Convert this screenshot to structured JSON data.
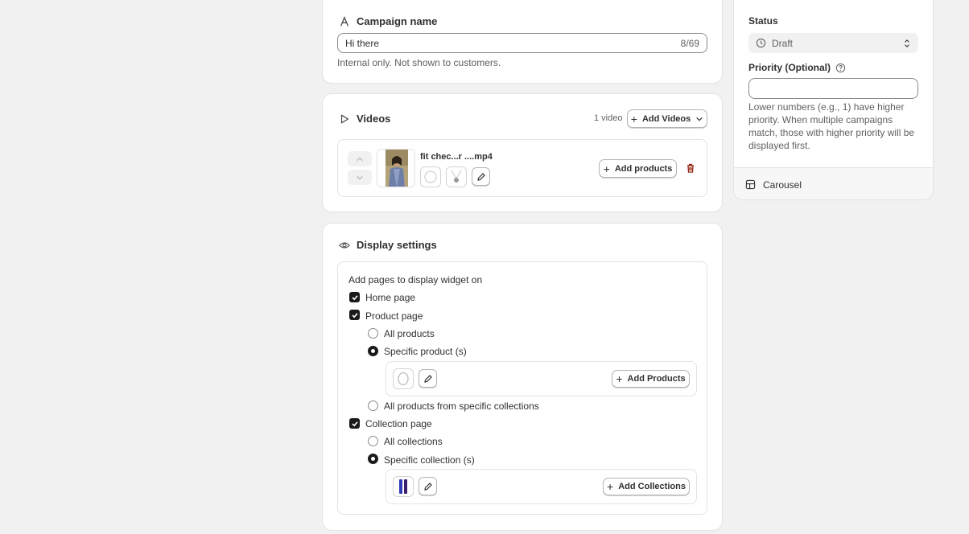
{
  "campaign_name": {
    "title": "Campaign name",
    "value": "Hi there",
    "counter": "8/69",
    "help": "Internal only. Not shown to customers."
  },
  "videos": {
    "title": "Videos",
    "count": "1 video",
    "add_label": "Add Videos",
    "item": {
      "filename": "fit chec...r ....mp4",
      "add_products_label": "Add products"
    }
  },
  "display_settings": {
    "title": "Display settings",
    "intro": "Add pages to display widget on",
    "home_page": "Home page",
    "product_page": "Product page",
    "all_products": "All products",
    "specific_products": "Specific product (s)",
    "add_products_label": "Add Products",
    "all_from_collections": "All products from specific collections",
    "collection_page": "Collection page",
    "all_collections": "All collections",
    "specific_collections": "Specific collection (s)",
    "add_collections_label": "Add Collections"
  },
  "sidebar": {
    "status_title": "Status",
    "status_value": "Draft",
    "priority_title": "Priority (Optional)",
    "priority_value": "",
    "priority_help": "Lower numbers (e.g., 1) have higher priority. When multiple campaigns match, those with higher priority will be displayed first.",
    "layout_label": "Carousel"
  },
  "colors": {
    "accent": "#1a1a1a",
    "danger": "#8e1f0b",
    "background": "#f1f1f1"
  }
}
